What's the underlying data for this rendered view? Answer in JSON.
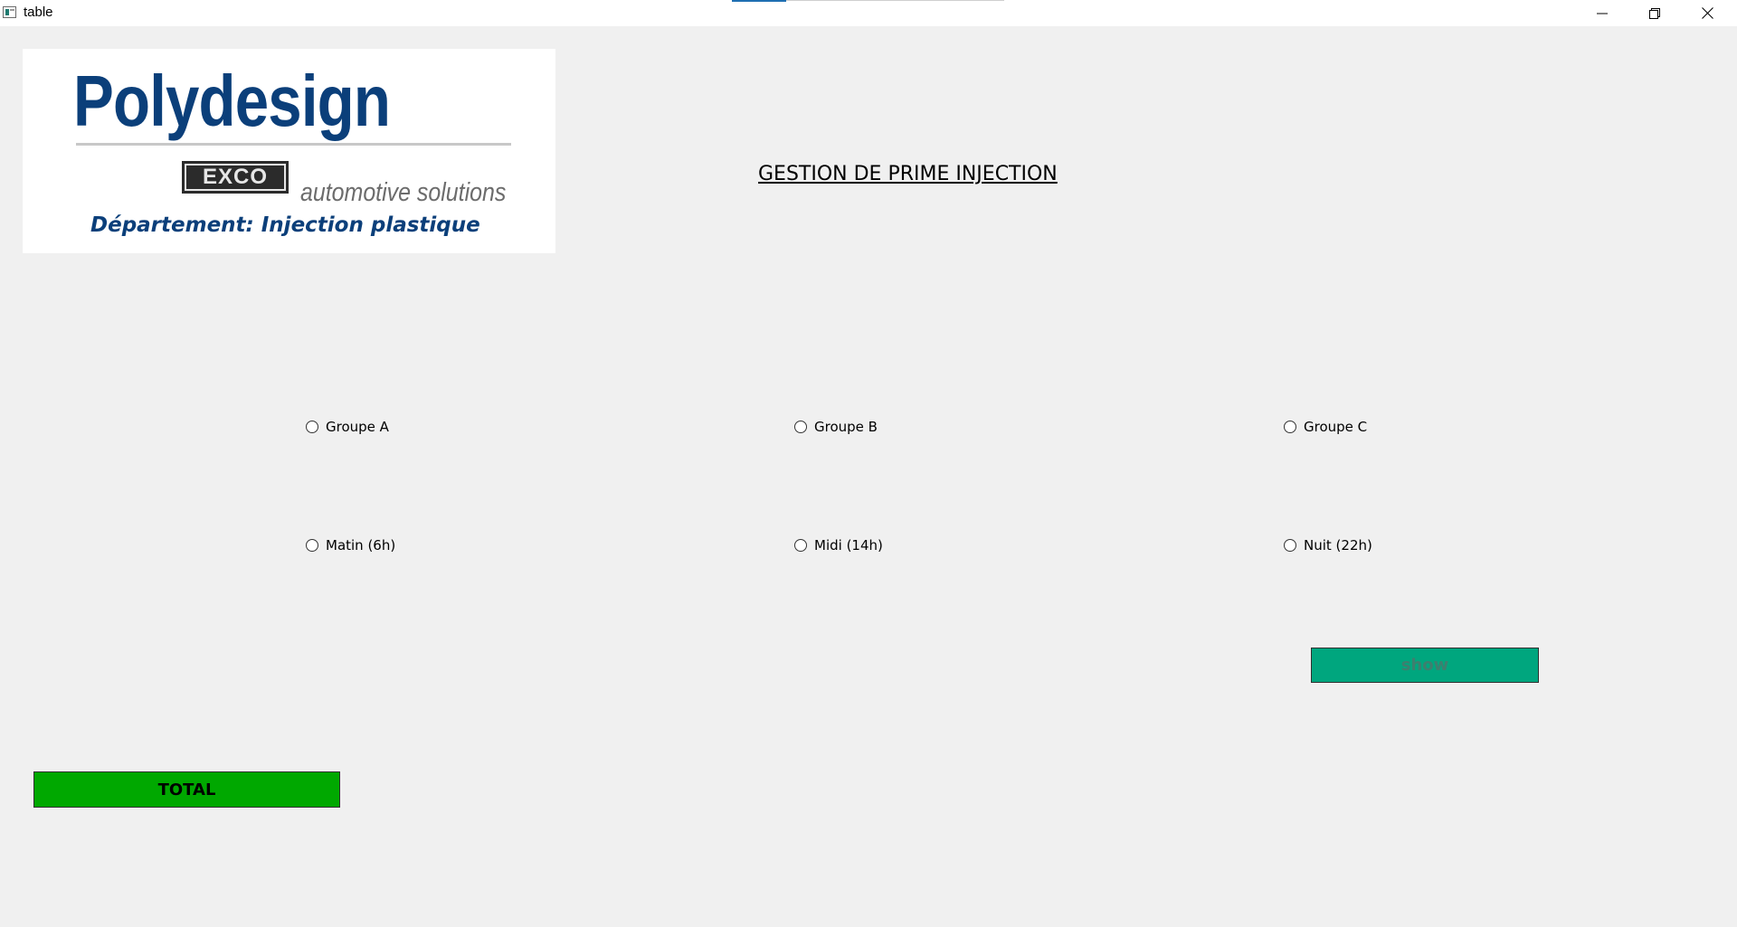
{
  "window": {
    "title": "table",
    "controls": [
      "minimize",
      "maximize",
      "close"
    ]
  },
  "logo": {
    "brand": "Polydesign",
    "sub_brand": "EXCO",
    "tagline": "automotive solutions",
    "department": "Département: Injection plastique",
    "colors": {
      "brand_blue": "#0b3f7a",
      "tagline_gray": "#6c6c6c"
    }
  },
  "heading": "GESTION DE PRIME INJECTION",
  "groups": [
    {
      "label": "Groupe A",
      "checked": false
    },
    {
      "label": "Groupe B",
      "checked": false
    },
    {
      "label": "Groupe C",
      "checked": false
    }
  ],
  "shifts": [
    {
      "label": "Matin (6h)",
      "checked": false
    },
    {
      "label": "Midi (14h)",
      "checked": false
    },
    {
      "label": "Nuit (22h)",
      "checked": false
    }
  ],
  "buttons": {
    "show_label": "show",
    "total_label": "TOTAL"
  },
  "colors": {
    "background": "#f0f0f0",
    "show_button": "#00a67e",
    "total_button": "#00a800"
  }
}
